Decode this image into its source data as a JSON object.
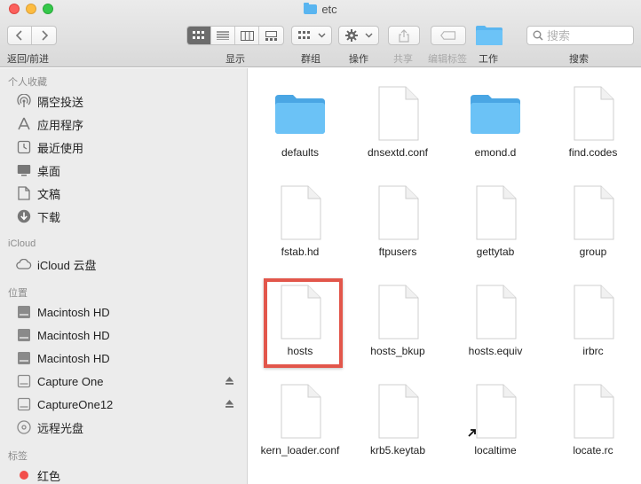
{
  "window": {
    "title": "etc"
  },
  "toolbar": {
    "back_forward_label": "返回/前进",
    "view_label": "显示",
    "group_label": "群组",
    "action_label": "操作",
    "share_label": "共享",
    "tags_label": "编辑标签",
    "work_label": "工作",
    "search_label": "搜索",
    "search_placeholder": "搜索"
  },
  "sidebar": {
    "favorites": {
      "title": "个人收藏",
      "items": [
        {
          "label": "隔空投送",
          "icon": "airdrop-icon"
        },
        {
          "label": "应用程序",
          "icon": "applications-icon"
        },
        {
          "label": "最近使用",
          "icon": "recents-icon"
        },
        {
          "label": "桌面",
          "icon": "desktop-icon"
        },
        {
          "label": "文稿",
          "icon": "documents-icon"
        },
        {
          "label": "下载",
          "icon": "downloads-icon"
        }
      ]
    },
    "icloud": {
      "title": "iCloud",
      "items": [
        {
          "label": "iCloud 云盘",
          "icon": "cloud-icon"
        }
      ]
    },
    "locations": {
      "title": "位置",
      "items": [
        {
          "label": "Macintosh HD",
          "icon": "disk-icon"
        },
        {
          "label": "Macintosh HD",
          "icon": "disk-icon"
        },
        {
          "label": "Macintosh HD",
          "icon": "disk-icon"
        },
        {
          "label": "Capture One",
          "icon": "external-disk-icon"
        },
        {
          "label": "CaptureOne12",
          "icon": "external-disk-icon"
        },
        {
          "label": "远程光盘",
          "icon": "remote-disc-icon"
        }
      ]
    },
    "tags": {
      "title": "标签",
      "items": [
        {
          "label": "红色",
          "color": "#f24e4a"
        }
      ]
    }
  },
  "files": [
    {
      "name": "defaults",
      "kind": "folder"
    },
    {
      "name": "dnsextd.conf",
      "kind": "document"
    },
    {
      "name": "emond.d",
      "kind": "folder"
    },
    {
      "name": "find.codes",
      "kind": "document"
    },
    {
      "name": "fstab.hd",
      "kind": "document"
    },
    {
      "name": "ftpusers",
      "kind": "document"
    },
    {
      "name": "gettytab",
      "kind": "document"
    },
    {
      "name": "group",
      "kind": "document"
    },
    {
      "name": "hosts",
      "kind": "document"
    },
    {
      "name": "hosts_bkup",
      "kind": "document"
    },
    {
      "name": "hosts.equiv",
      "kind": "document"
    },
    {
      "name": "irbrc",
      "kind": "document"
    },
    {
      "name": "kern_loader.conf",
      "kind": "document"
    },
    {
      "name": "krb5.keytab",
      "kind": "document"
    },
    {
      "name": "localtime",
      "kind": "alias"
    },
    {
      "name": "locate.rc",
      "kind": "document"
    }
  ],
  "colors": {
    "folder": "#5ab6f0",
    "highlight": "#e2564b",
    "sidebar_bg": "#ececec"
  }
}
